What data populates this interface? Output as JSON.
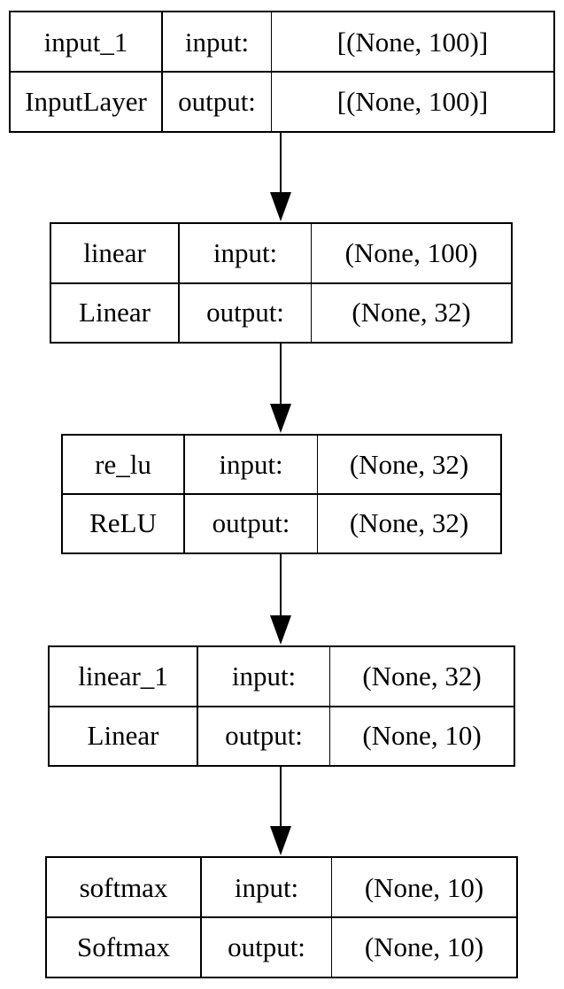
{
  "diagram": {
    "type": "keras-model-plot",
    "nodes": [
      {
        "name": "input_1",
        "class": "InputLayer",
        "input_label": "input:",
        "output_label": "output:",
        "input_shape": "[(None, 100)]",
        "output_shape": "[(None, 100)]"
      },
      {
        "name": "linear",
        "class": "Linear",
        "input_label": "input:",
        "output_label": "output:",
        "input_shape": "(None, 100)",
        "output_shape": "(None, 32)"
      },
      {
        "name": "re_lu",
        "class": "ReLU",
        "input_label": "input:",
        "output_label": "output:",
        "input_shape": "(None, 32)",
        "output_shape": "(None, 32)"
      },
      {
        "name": "linear_1",
        "class": "Linear",
        "input_label": "input:",
        "output_label": "output:",
        "input_shape": "(None, 32)",
        "output_shape": "(None, 10)"
      },
      {
        "name": "softmax",
        "class": "Softmax",
        "input_label": "input:",
        "output_label": "output:",
        "input_shape": "(None, 10)",
        "output_shape": "(None, 10)"
      }
    ],
    "edges": [
      {
        "from": "input_1",
        "to": "linear"
      },
      {
        "from": "linear",
        "to": "re_lu"
      },
      {
        "from": "re_lu",
        "to": "linear_1"
      },
      {
        "from": "linear_1",
        "to": "softmax"
      }
    ]
  }
}
